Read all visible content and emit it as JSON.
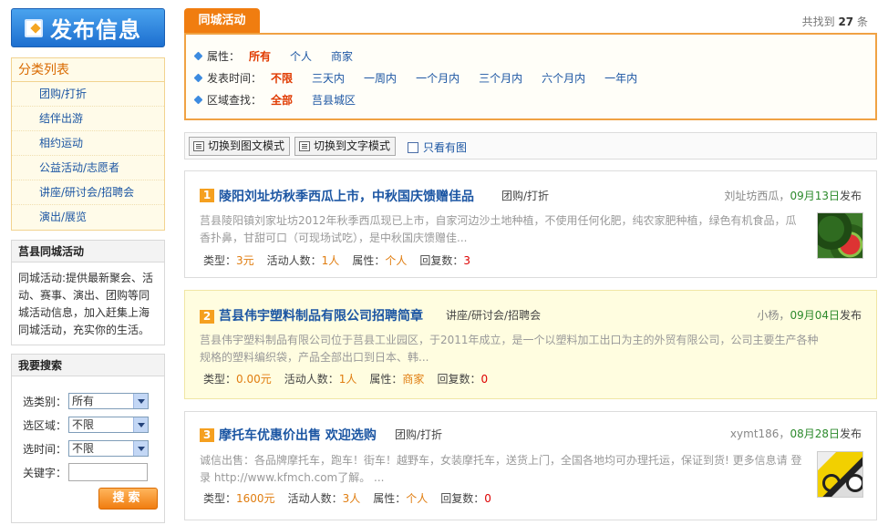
{
  "sidebar": {
    "publish_label": "发布信息",
    "categories": {
      "title": "分类列表",
      "items": [
        "团购/打折",
        "结伴出游",
        "相约运动",
        "公益活动/志愿者",
        "讲座/研讨会/招聘会",
        "演出/展览"
      ]
    },
    "about": {
      "title": "莒县同城活动",
      "text": "同城活动:提供最新聚会、活动、赛事、演出、团购等同城活动信息，加入赶集上海同城活动，充实你的生活。"
    },
    "search": {
      "title": "我要搜索",
      "category_label": "选类别：",
      "category_value": "所有",
      "region_label": "选区域：",
      "region_value": "不限",
      "time_label": "选时间：",
      "time_value": "不限",
      "keyword_label": "关键字：",
      "keyword_value": "",
      "button_label": "搜索"
    }
  },
  "main": {
    "tab_label": "同城活动",
    "found": {
      "prefix": "共找到",
      "count": "27",
      "suffix": "条"
    },
    "filters": {
      "attribute": {
        "label": "属性：",
        "options": [
          "所有",
          "个人",
          "商家"
        ],
        "active": "所有"
      },
      "time": {
        "label": "发表时间：",
        "options": [
          "不限",
          "三天内",
          "一周内",
          "一个月内",
          "三个月内",
          "六个月内",
          "一年内"
        ],
        "active": "不限"
      },
      "region": {
        "label": "区域查找：",
        "options": [
          "全部",
          "莒县城区"
        ],
        "active": "全部"
      }
    },
    "toolbar": {
      "image_mode": "切换到图文模式",
      "text_mode": "切换到文字模式",
      "only_images": "只看有图"
    },
    "posts": [
      {
        "rank": "1",
        "title": "陵阳刘址坊秋季西瓜上市，中秋国庆馈赠佳品",
        "category": "团购/打折",
        "author": "刘址坊西瓜，",
        "date": "09月13日",
        "publish_suffix": "发布",
        "desc": "莒县陵阳镇刘家址坊2012年秋季西瓜现已上市，自家河边沙土地种植，不使用任何化肥，纯农家肥种植，绿色有机食品，瓜香扑鼻，甘甜可口（可现场试吃），是中秋国庆馈赠佳...",
        "type_label": "类型：",
        "type_value": "3元",
        "people_label": "活动人数：",
        "people_value": "1人",
        "attr_label": "属性：",
        "attr_value": "个人",
        "reply_label": "回复数：",
        "reply_value": "3",
        "thumb": "watermelon-photo"
      },
      {
        "rank": "2",
        "title": "莒县伟宇塑料制品有限公司招聘简章",
        "category": "讲座/研讨会/招聘会",
        "author": "小杨，",
        "date": "09月04日",
        "publish_suffix": "发布",
        "desc": "莒县伟宇塑料制品有限公司位于莒县工业园区，于2011年成立，是一个以塑料加工出口为主的外贸有限公司，公司主要生产各种规格的塑料编织袋，产品全部出口到日本、韩...",
        "type_label": "类型：",
        "type_value": "0.00元",
        "people_label": "活动人数：",
        "people_value": "1人",
        "attr_label": "属性：",
        "attr_value": "商家",
        "reply_label": "回复数：",
        "reply_value": "0",
        "thumb": ""
      },
      {
        "rank": "3",
        "title": "摩托车优惠价出售 欢迎选购",
        "category": "团购/打折",
        "author": "xymt186，",
        "date": "08月28日",
        "publish_suffix": "发布",
        "desc": "诚信出售：各品牌摩托车，跑车！街车！越野车，女装摩托车，送货上门，全国各地均可办理托运，保证到货! 更多信息请 登录 http://www.kfmch.com了解。 ...",
        "type_label": "类型：",
        "type_value": "1600元",
        "people_label": "活动人数：",
        "people_value": "3人",
        "attr_label": "属性：",
        "attr_value": "个人",
        "reply_label": "回复数：",
        "reply_value": "0",
        "thumb": "motorcycle-photo"
      }
    ]
  },
  "colors": {
    "accent": "#f07d10",
    "link": "#1c56a3",
    "active_filter": "#e03a00",
    "date_green": "#2c8a2c",
    "highlight_bg": "#fffde0"
  }
}
